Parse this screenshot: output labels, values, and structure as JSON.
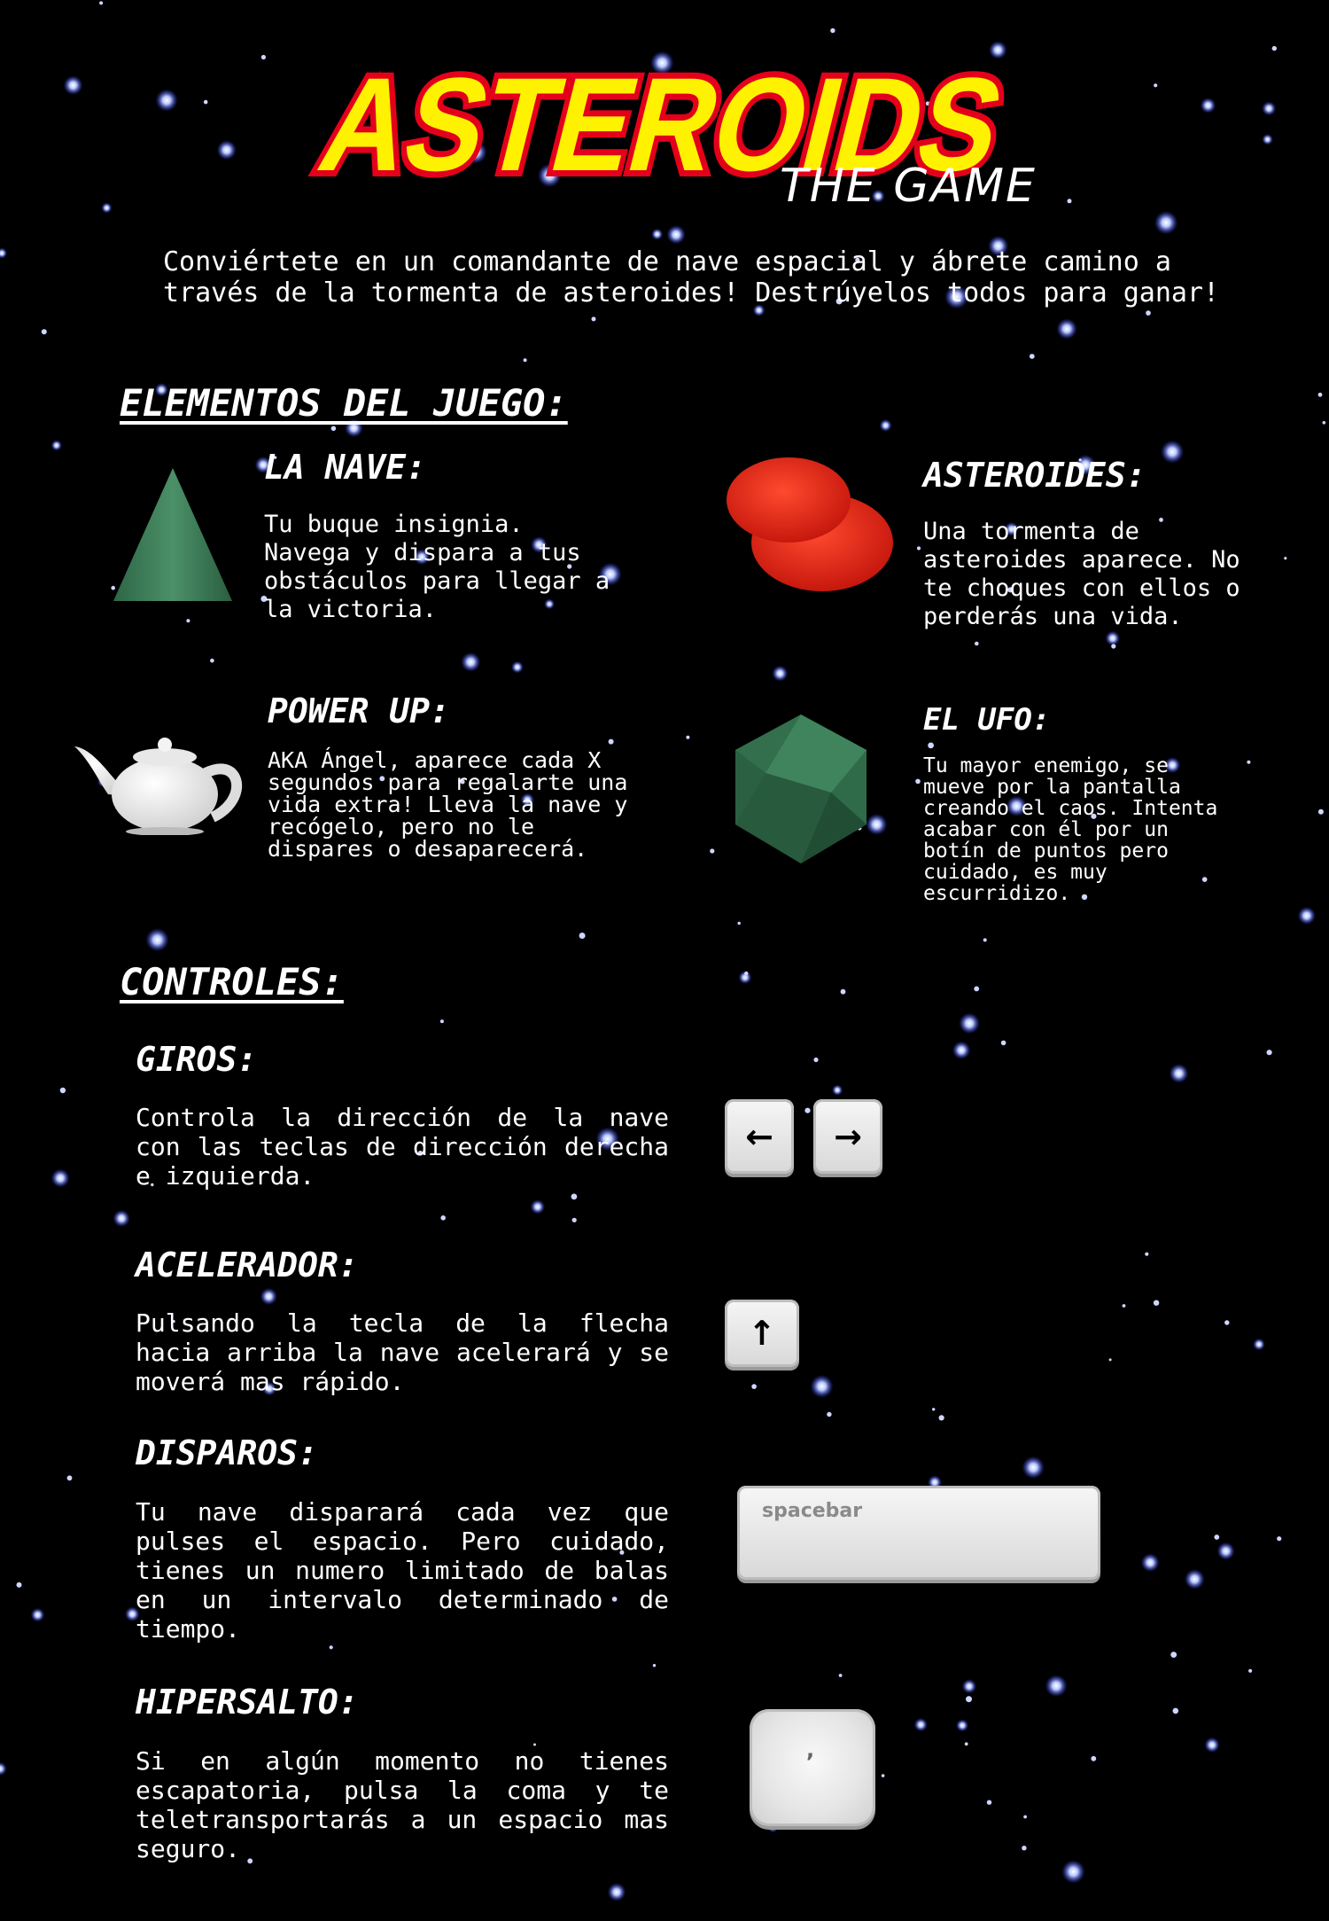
{
  "logo": {
    "title": "ASTEROIDS",
    "subtitle": "THE GAME"
  },
  "intro": "Conviértete en un comandante de nave espacial y ábrete camino a\ntravés de la tormenta de asteroides! Destrúyelos todos para ganar!",
  "elements": {
    "heading": "ELEMENTOS DEL JUEGO:",
    "nave": {
      "title": "LA NAVE:",
      "text": "Tu buque insignia.\nNavega y dispara a tus obstáculos para llegar a la victoria."
    },
    "asteroides": {
      "title": "ASTEROIDES:",
      "text": "Una tormenta de asteroides aparece. No te choques con ellos o perderás una vida."
    },
    "powerup": {
      "title": "POWER UP:",
      "text": "AKA Ángel, aparece cada X segundos para regalarte una vida extra! Lleva la nave y recógelo, pero no le dispares o desaparecerá."
    },
    "ufo": {
      "title": "EL UFO:",
      "text": "Tu mayor enemigo, se mueve por la pantalla creando el caos. Intenta acabar con él por un botín de puntos pero cuidado, es muy escurridizo."
    }
  },
  "controls": {
    "heading": "CONTROLES:",
    "giros": {
      "title": "GIROS:",
      "text": "Controla la dirección de la nave con las teclas de dirección derecha e izquierda."
    },
    "acelerador": {
      "title": "ACELERADOR:",
      "text": "Pulsando la tecla de la flecha hacia arriba la nave acelerará y se moverá mas rápido."
    },
    "disparos": {
      "title": "DISPAROS:",
      "text": "Tu nave disparará cada vez que pulses el espacio. Pero cuidado, tienes un numero limitado de balas en un intervalo determinado de tiempo."
    },
    "hipersalto": {
      "title": "HIPERSALTO:",
      "text": "Si en algún momento no tienes escapatoria, pulsa la coma y te teletransportarás a un espacio mas seguro."
    }
  },
  "keys": {
    "left": "←",
    "right": "→",
    "up": "↑",
    "spacebar": "spacebar",
    "comma": ","
  },
  "colors": {
    "background": "#000000",
    "logo_fill": "#fff200",
    "logo_stroke": "#e4001b",
    "ship": "#3a7a55",
    "asteroid": "#e5281c",
    "ufo": "#2f6b48"
  }
}
